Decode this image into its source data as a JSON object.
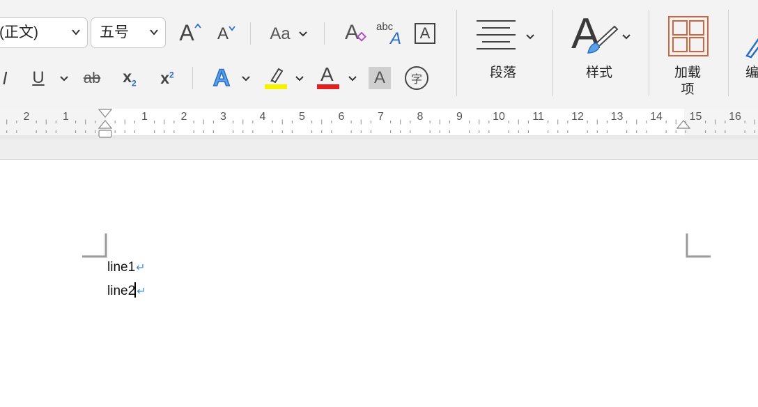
{
  "font": {
    "family_value": "(正文)",
    "size_value": "五号"
  },
  "toolbar": {
    "grow_font_glyph": "A",
    "shrink_font_glyph": "A",
    "change_case_glyph": "Aa",
    "text_effects_glyph": "A",
    "font_color_glyph": "A",
    "char_shading_glyph": "A",
    "enclose_char_glyph": "字",
    "spelling_abc": "abc",
    "spelling_glyph": "A",
    "char_border_glyph": "A",
    "italic_glyph": "I",
    "underline_glyph": "U",
    "strike_glyph": "ab",
    "subscript_glyph": "x",
    "subscript_index": "2",
    "superscript_glyph": "x",
    "superscript_index": "2",
    "clear_format_glyph": "A"
  },
  "groups": {
    "paragraph_label": "段落",
    "styles_label": "样式",
    "styles_glyph": "A",
    "addins_label_line1": "加载",
    "addins_label_line2": "项",
    "editing_label": "编"
  },
  "colors": {
    "highlight": "#f5f100",
    "font_color": "#e02020",
    "accent_blue": "#2b6cc4",
    "addin_orange": "#d0643f",
    "eraser_purple": "#b04fc8"
  },
  "ruler": {
    "left_numbers": [
      "2",
      "1"
    ],
    "right_numbers": [
      "1",
      "2",
      "3",
      "4",
      "5",
      "6",
      "7",
      "8",
      "9",
      "10",
      "11",
      "12",
      "13",
      "14",
      "15",
      "16"
    ]
  },
  "document": {
    "lines": [
      "line1",
      "line2"
    ],
    "paragraph_mark": "↵"
  }
}
